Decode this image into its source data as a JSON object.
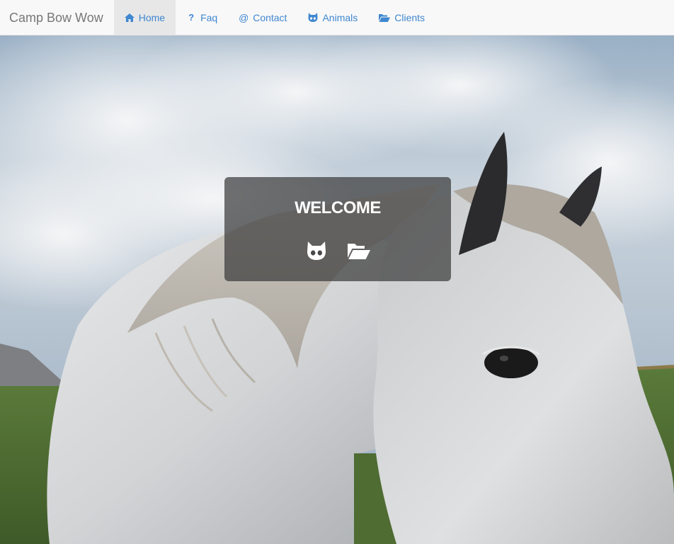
{
  "brand": {
    "name": "Camp Bow Wow"
  },
  "nav": {
    "items": [
      {
        "label": "Home",
        "icon": "home-icon",
        "active": true
      },
      {
        "label": "Faq",
        "icon": "question-icon",
        "glyph": "?"
      },
      {
        "label": "Contact",
        "icon": "at-icon",
        "glyph": "@"
      },
      {
        "label": "Animals",
        "icon": "cat-icon"
      },
      {
        "label": "Clients",
        "icon": "folder-open-icon"
      }
    ]
  },
  "welcome": {
    "title": "WELCOME",
    "icons": [
      "cat-icon",
      "folder-open-icon"
    ]
  },
  "colors": {
    "link": "#3f87d1",
    "brand_text": "#777777",
    "navbar_bg": "#f8f8f8",
    "active_bg": "#e7e7e7",
    "card_bg": "#3c3c3c"
  }
}
